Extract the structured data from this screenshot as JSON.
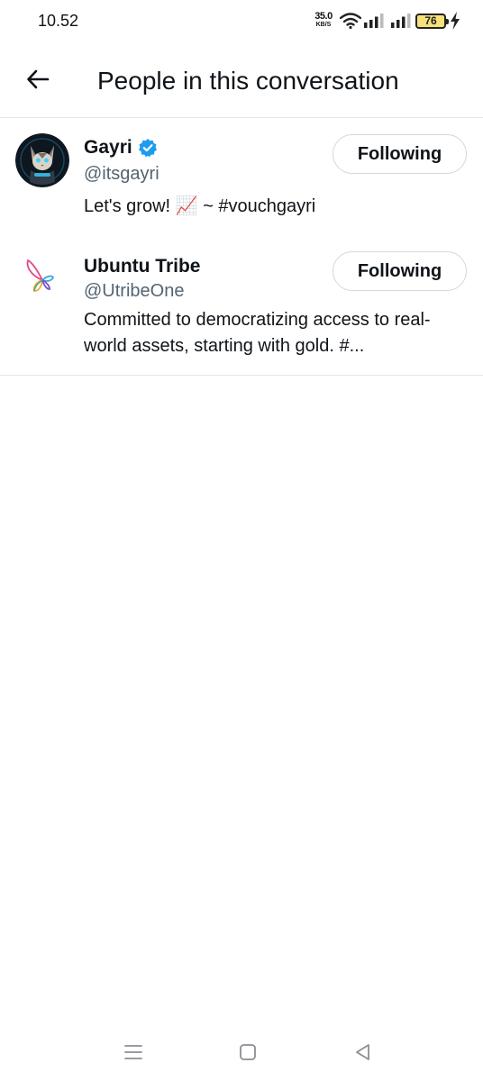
{
  "status_bar": {
    "time": "10.52",
    "net_speed_value": "35.0",
    "net_speed_unit": "KB/S",
    "battery": "76",
    "icons": [
      "wifi-icon",
      "signal-icon",
      "signal-icon",
      "battery-icon",
      "charging-icon"
    ]
  },
  "header": {
    "title": "People in this conversation",
    "back_icon": "arrow-left-icon"
  },
  "users": [
    {
      "name": "Gayri",
      "verified": true,
      "handle": "@itsgayri",
      "bio": "Let's grow! 📈 ~ #vouchgayri",
      "follow_label": "Following"
    },
    {
      "name": "Ubuntu Tribe",
      "verified": false,
      "handle": "@UtribeOne",
      "bio": "Committed to democratizing access to real-world assets, starting with gold. #...",
      "follow_label": "Following"
    }
  ],
  "nav_bar": {
    "icons": [
      "menu-icon",
      "home-square-icon",
      "back-triangle-icon"
    ]
  },
  "colors": {
    "text": "#0f1419",
    "secondary_text": "#536471",
    "verified_blue": "#1d9bf0",
    "border": "#cfd9de",
    "battery_fill": "#f6e27a"
  }
}
